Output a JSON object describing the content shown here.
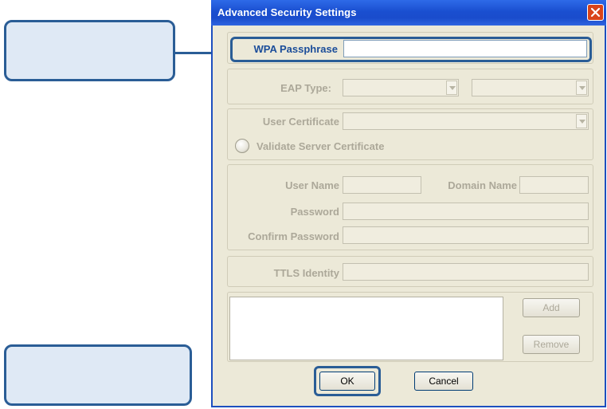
{
  "dialog": {
    "title": "Advanced Security Settings"
  },
  "wpa": {
    "passphrase_label": "WPA Passphrase",
    "passphrase_value": ""
  },
  "eap": {
    "type_label": "EAP Type:",
    "type_value": "",
    "subtype_value": ""
  },
  "certificate": {
    "user_certificate_label": "User Certificate",
    "user_certificate_value": "",
    "validate_server_label": "Validate Server Certificate"
  },
  "credentials": {
    "user_name_label": "User Name",
    "domain_name_label": "Domain Name",
    "password_label": "Password",
    "confirm_password_label": "Confirm Password"
  },
  "ttls": {
    "identity_label": "TTLS Identity"
  },
  "buttons": {
    "add": "Add",
    "remove": "Remove",
    "ok": "OK",
    "cancel": "Cancel"
  },
  "colors": {
    "callout_fill": "#dfe9f5",
    "callout_border": "#2a5d96",
    "titlebar": "#1a4fd0",
    "dialog_bg": "#ece9d8",
    "active_label": "#1b4d9a",
    "disabled_label": "#aca899"
  }
}
